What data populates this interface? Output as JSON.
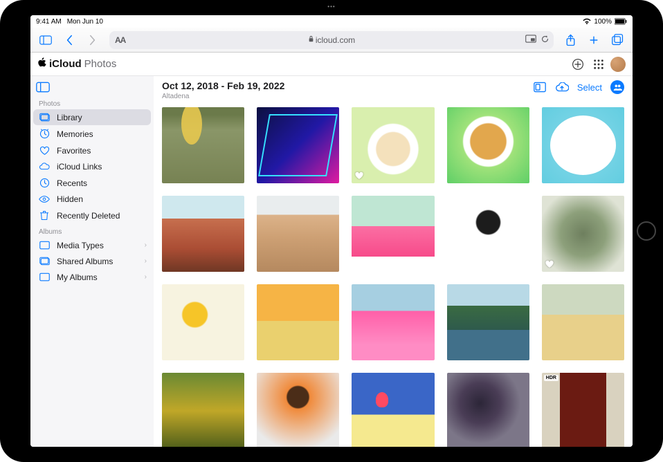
{
  "status": {
    "time": "9:41 AM",
    "date": "Mon Jun 10",
    "battery_pct": "100%"
  },
  "safari": {
    "url_display": "icloud.com"
  },
  "app_header": {
    "brand_icloud": "iCloud",
    "brand_photos": "Photos"
  },
  "sidebar": {
    "section_photos": "Photos",
    "items_photos": [
      {
        "icon": "library-icon",
        "label": "Library",
        "selected": true
      },
      {
        "icon": "memories-icon",
        "label": "Memories"
      },
      {
        "icon": "heart-icon",
        "label": "Favorites"
      },
      {
        "icon": "cloud-link-icon",
        "label": "iCloud Links"
      },
      {
        "icon": "clock-icon",
        "label": "Recents"
      },
      {
        "icon": "eye-icon",
        "label": "Hidden"
      },
      {
        "icon": "trash-icon",
        "label": "Recently Deleted"
      }
    ],
    "section_albums": "Albums",
    "items_albums": [
      {
        "icon": "mediatypes-icon",
        "label": "Media Types",
        "chevron": true
      },
      {
        "icon": "shared-albums-icon",
        "label": "Shared Albums",
        "chevron": true
      },
      {
        "icon": "my-albums-icon",
        "label": "My Albums",
        "chevron": true
      }
    ]
  },
  "content": {
    "date_range": "Oct 12, 2018 - Feb 19, 2022",
    "location": "Altadena",
    "select_label": "Select",
    "hdr_badge": "HDR"
  },
  "photos": [
    {
      "name": "photo-water-float",
      "favorite": false
    },
    {
      "name": "photo-neon-sign",
      "favorite": false
    },
    {
      "name": "photo-pastry-plate",
      "favorite": true
    },
    {
      "name": "photo-concha-bread",
      "favorite": false
    },
    {
      "name": "photo-cookies-plate",
      "favorite": false
    },
    {
      "name": "photo-red-canyon",
      "favorite": false
    },
    {
      "name": "photo-desert-rocks",
      "favorite": false
    },
    {
      "name": "photo-pink-cake",
      "favorite": false
    },
    {
      "name": "photo-bw-portrait",
      "favorite": false
    },
    {
      "name": "photo-succulent",
      "favorite": true
    },
    {
      "name": "photo-yellow-flower",
      "favorite": false
    },
    {
      "name": "photo-sweater-portrait",
      "favorite": false
    },
    {
      "name": "photo-pink-dress",
      "favorite": false
    },
    {
      "name": "photo-mountain-lake",
      "favorite": false
    },
    {
      "name": "photo-striped-sweater",
      "favorite": false
    },
    {
      "name": "photo-moss-closeup",
      "favorite": false
    },
    {
      "name": "photo-orange-shirt",
      "favorite": false
    },
    {
      "name": "photo-still-life",
      "favorite": false
    },
    {
      "name": "photo-figs",
      "favorite": false
    },
    {
      "name": "photo-doorway",
      "favorite": false,
      "hdr": true
    }
  ]
}
